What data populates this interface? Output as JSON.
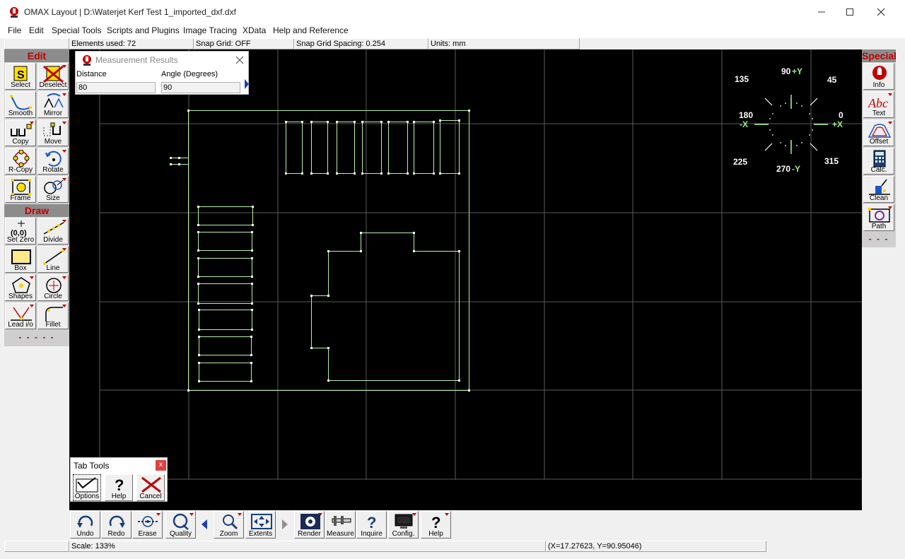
{
  "window": {
    "title": "OMAX Layout | D:\\Waterjet Kerf Test 1_imported_dxf.dxf",
    "minimize_icon": "minimize-icon",
    "maximize_icon": "maximize-icon",
    "close_icon": "close-icon"
  },
  "menu": [
    "File",
    "Edit",
    "Special Tools",
    "Scripts and Plugins",
    "Image Tracing",
    "XData",
    "Help and Reference"
  ],
  "status_top": {
    "elements_used": "Elements used: 72",
    "snap_grid": "Snap Grid: OFF",
    "snap_spacing": "Snap Grid Spacing: 0.254",
    "units": "Units: mm"
  },
  "left_panel": {
    "edit_header": "Edit",
    "edit_tools": [
      "Select",
      "Deselect",
      "Smooth",
      "Mirror",
      "Copy",
      "Move",
      "R-Copy",
      "Rotate",
      "Frame",
      "Size"
    ],
    "draw_header": "Draw",
    "draw_tools": [
      "Set Zero",
      "Divide",
      "Box",
      "Line",
      "Shapes",
      "Circle",
      "Lead i/o",
      "Fillet"
    ],
    "more": "- - - - -"
  },
  "right_panel": {
    "header": "Special",
    "tools": [
      "Info",
      "Text",
      "Offset",
      "Calc.",
      "Clean",
      "Path"
    ],
    "more": "- - -"
  },
  "measurement": {
    "title": "Measurement Results",
    "distance_label": "Distance",
    "distance_value": "80",
    "angle_label": "Angle (Degrees)",
    "angle_value": "90"
  },
  "compass": {
    "n": "90",
    "n_axis": "+Y",
    "ne": "45",
    "e": "0",
    "e_axis": "+X",
    "w": "180",
    "w_axis": "-X",
    "nw": "135",
    "sw": "225",
    "s": "270",
    "s_axis": "-Y",
    "se": "315"
  },
  "tab_tools": {
    "title": "Tab Tools",
    "close": "x",
    "buttons": [
      "Options",
      "Help",
      "Cancel"
    ]
  },
  "bottom_tools": [
    "Undo",
    "Redo",
    "Erase",
    "Quality",
    "Zoom",
    "Extents",
    "Render",
    "Measure",
    "Inquire",
    "Config.",
    "Help"
  ],
  "status_bottom": {
    "scale": "Scale: 133%",
    "coords": "(X=17.27623, Y=90.95046)"
  },
  "colors": {
    "canvas": "#000000",
    "geometry": "#b8f0a8",
    "grid": "#5a5a5a",
    "accent_red": "#c00000"
  }
}
